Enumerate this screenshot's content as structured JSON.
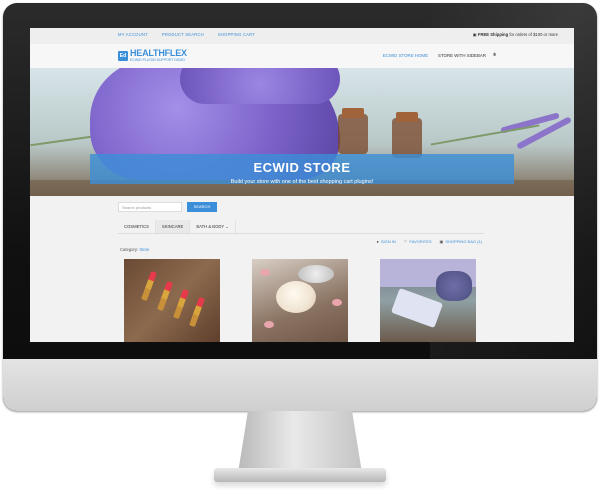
{
  "topbar": {
    "links": [
      "MY ACCOUNT",
      "PRODUCT SEARCH",
      "SHOPPING CART"
    ],
    "shipping_bold": "FREE Shipping",
    "shipping_rest": "for orders of $100 or more"
  },
  "header": {
    "logo_mark": "Ed",
    "brand": "HEALTHFLEX",
    "tagline": "ECWID PLUGIN SUPPORT DEMO",
    "nav": [
      "ECWID STORE HOME",
      "STORE WITH SIDEBAR"
    ]
  },
  "hero": {
    "title": "ECWID STORE",
    "subtitle": "Build your store with one of the best shopping cart plugins!"
  },
  "store": {
    "search_placeholder": "Search products",
    "search_button": "SEARCH",
    "categories": [
      "COSMETICS",
      "SKINCARE",
      "BATH & BODY"
    ],
    "account_links": [
      "SIGN IN",
      "FAVORITES",
      "SHOPPING BAG (1)"
    ],
    "crumb_label": "Category:",
    "crumb_link": "Store"
  },
  "colors": {
    "accent": "#3b8fd8",
    "bezel": "#111111",
    "chin": "#d9d9d9"
  }
}
